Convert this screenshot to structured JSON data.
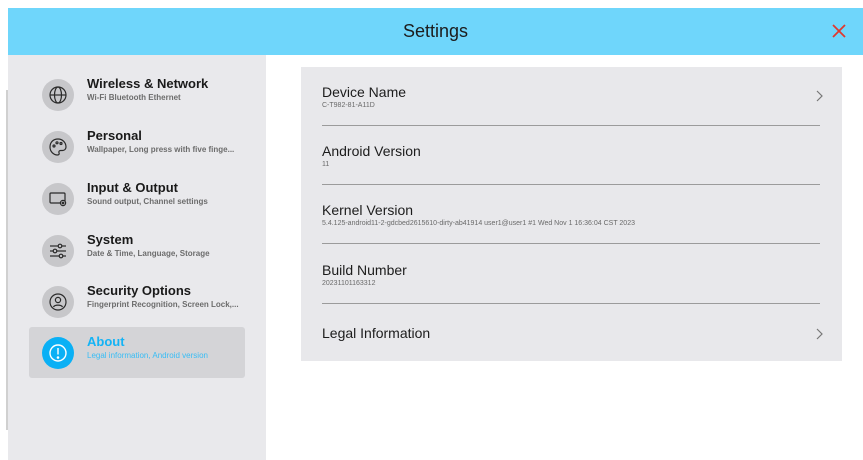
{
  "header": {
    "title": "Settings"
  },
  "colors": {
    "accent": "#0ab0f5",
    "header_bg": "#6fd6fb",
    "close": "#e0382e"
  },
  "sidebar": {
    "items": [
      {
        "label": "Wireless & Network",
        "sub": "Wi-Fi Bluetooth Ethernet",
        "icon": "globe-icon",
        "active": false
      },
      {
        "label": "Personal",
        "sub": "Wallpaper, Long press with five finge...",
        "icon": "palette-icon",
        "active": false
      },
      {
        "label": "Input & Output",
        "sub": "Sound output, Channel settings",
        "icon": "monitor-gear-icon",
        "active": false
      },
      {
        "label": "System",
        "sub": "Date & Time, Language, Storage",
        "icon": "sliders-icon",
        "active": false
      },
      {
        "label": "Security Options",
        "sub": "Fingerprint Recognition, Screen Lock,...",
        "icon": "user-lock-icon",
        "active": false
      },
      {
        "label": "About",
        "sub": "Legal information, Android version",
        "icon": "info-icon",
        "active": true
      }
    ]
  },
  "about": {
    "rows": [
      {
        "title": "Device Name",
        "value": "C-T982-81-A11D",
        "chevron": true
      },
      {
        "title": "Android Version",
        "value": "11",
        "chevron": false
      },
      {
        "title": "Kernel Version",
        "value": "5.4.125-android11-2-gdcbed2615610-dirty-ab41914   user1@user1 #1 Wed Nov 1 16:36:04 CST 2023",
        "chevron": false
      },
      {
        "title": "Build Number",
        "value": "20231101163312",
        "chevron": false
      },
      {
        "title": "Legal Information",
        "value": "",
        "chevron": true
      }
    ]
  }
}
